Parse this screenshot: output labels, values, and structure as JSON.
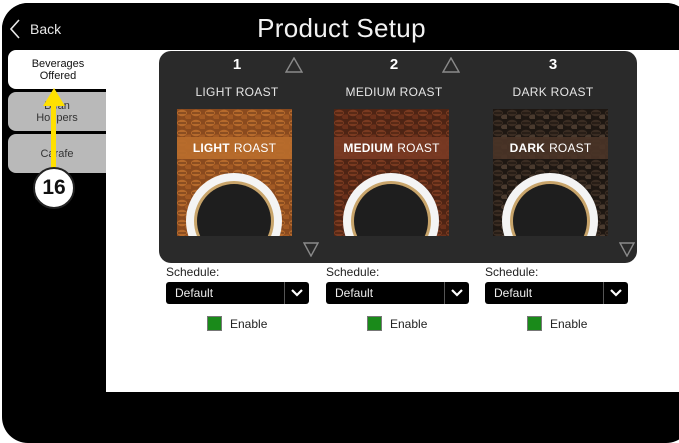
{
  "header": {
    "back_label": "Back",
    "title": "Product Setup"
  },
  "tabs": [
    {
      "line1": "Beverages",
      "line2": "Offered",
      "active": true
    },
    {
      "line1": "Bean",
      "line2": "Hoppers",
      "active": false
    },
    {
      "line1": "Carafe",
      "line2": "",
      "active": false
    }
  ],
  "products": [
    {
      "number": "1",
      "name": "LIGHT ROAST",
      "band_bold": "LIGHT",
      "band_rest": "ROAST",
      "band_color": "#b86d2c",
      "schedule_label": "Schedule:",
      "schedule_value": "Default",
      "enable_label": "Enable",
      "enabled": true
    },
    {
      "number": "2",
      "name": "MEDIUM ROAST",
      "band_bold": "MEDIUM",
      "band_rest": "ROAST",
      "band_color": "#7a3b24",
      "schedule_label": "Schedule:",
      "schedule_value": "Default",
      "enable_label": "Enable",
      "enabled": true
    },
    {
      "number": "3",
      "name": "DARK ROAST",
      "band_bold": "DARK",
      "band_rest": "ROAST",
      "band_color": "#4a3427",
      "schedule_label": "Schedule:",
      "schedule_value": "Default",
      "enable_label": "Enable",
      "enabled": true
    }
  ],
  "callout": {
    "number": "16",
    "color": "#ffe000"
  }
}
